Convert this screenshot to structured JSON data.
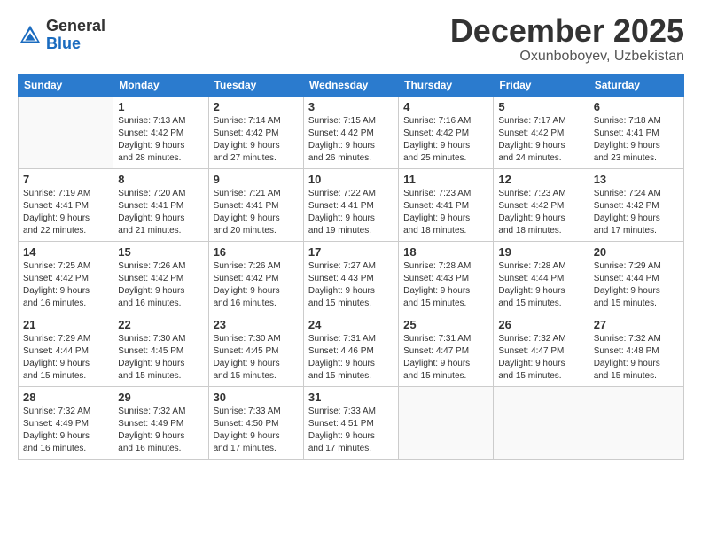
{
  "logo": {
    "general": "General",
    "blue": "Blue"
  },
  "header": {
    "month": "December 2025",
    "location": "Oxunboboyev, Uzbekistan"
  },
  "weekdays": [
    "Sunday",
    "Monday",
    "Tuesday",
    "Wednesday",
    "Thursday",
    "Friday",
    "Saturday"
  ],
  "weeks": [
    [
      {
        "day": "",
        "info": ""
      },
      {
        "day": "1",
        "info": "Sunrise: 7:13 AM\nSunset: 4:42 PM\nDaylight: 9 hours\nand 28 minutes."
      },
      {
        "day": "2",
        "info": "Sunrise: 7:14 AM\nSunset: 4:42 PM\nDaylight: 9 hours\nand 27 minutes."
      },
      {
        "day": "3",
        "info": "Sunrise: 7:15 AM\nSunset: 4:42 PM\nDaylight: 9 hours\nand 26 minutes."
      },
      {
        "day": "4",
        "info": "Sunrise: 7:16 AM\nSunset: 4:42 PM\nDaylight: 9 hours\nand 25 minutes."
      },
      {
        "day": "5",
        "info": "Sunrise: 7:17 AM\nSunset: 4:42 PM\nDaylight: 9 hours\nand 24 minutes."
      },
      {
        "day": "6",
        "info": "Sunrise: 7:18 AM\nSunset: 4:41 PM\nDaylight: 9 hours\nand 23 minutes."
      }
    ],
    [
      {
        "day": "7",
        "info": "Sunrise: 7:19 AM\nSunset: 4:41 PM\nDaylight: 9 hours\nand 22 minutes."
      },
      {
        "day": "8",
        "info": "Sunrise: 7:20 AM\nSunset: 4:41 PM\nDaylight: 9 hours\nand 21 minutes."
      },
      {
        "day": "9",
        "info": "Sunrise: 7:21 AM\nSunset: 4:41 PM\nDaylight: 9 hours\nand 20 minutes."
      },
      {
        "day": "10",
        "info": "Sunrise: 7:22 AM\nSunset: 4:41 PM\nDaylight: 9 hours\nand 19 minutes."
      },
      {
        "day": "11",
        "info": "Sunrise: 7:23 AM\nSunset: 4:41 PM\nDaylight: 9 hours\nand 18 minutes."
      },
      {
        "day": "12",
        "info": "Sunrise: 7:23 AM\nSunset: 4:42 PM\nDaylight: 9 hours\nand 18 minutes."
      },
      {
        "day": "13",
        "info": "Sunrise: 7:24 AM\nSunset: 4:42 PM\nDaylight: 9 hours\nand 17 minutes."
      }
    ],
    [
      {
        "day": "14",
        "info": "Sunrise: 7:25 AM\nSunset: 4:42 PM\nDaylight: 9 hours\nand 16 minutes."
      },
      {
        "day": "15",
        "info": "Sunrise: 7:26 AM\nSunset: 4:42 PM\nDaylight: 9 hours\nand 16 minutes."
      },
      {
        "day": "16",
        "info": "Sunrise: 7:26 AM\nSunset: 4:42 PM\nDaylight: 9 hours\nand 16 minutes."
      },
      {
        "day": "17",
        "info": "Sunrise: 7:27 AM\nSunset: 4:43 PM\nDaylight: 9 hours\nand 15 minutes."
      },
      {
        "day": "18",
        "info": "Sunrise: 7:28 AM\nSunset: 4:43 PM\nDaylight: 9 hours\nand 15 minutes."
      },
      {
        "day": "19",
        "info": "Sunrise: 7:28 AM\nSunset: 4:44 PM\nDaylight: 9 hours\nand 15 minutes."
      },
      {
        "day": "20",
        "info": "Sunrise: 7:29 AM\nSunset: 4:44 PM\nDaylight: 9 hours\nand 15 minutes."
      }
    ],
    [
      {
        "day": "21",
        "info": "Sunrise: 7:29 AM\nSunset: 4:44 PM\nDaylight: 9 hours\nand 15 minutes."
      },
      {
        "day": "22",
        "info": "Sunrise: 7:30 AM\nSunset: 4:45 PM\nDaylight: 9 hours\nand 15 minutes."
      },
      {
        "day": "23",
        "info": "Sunrise: 7:30 AM\nSunset: 4:45 PM\nDaylight: 9 hours\nand 15 minutes."
      },
      {
        "day": "24",
        "info": "Sunrise: 7:31 AM\nSunset: 4:46 PM\nDaylight: 9 hours\nand 15 minutes."
      },
      {
        "day": "25",
        "info": "Sunrise: 7:31 AM\nSunset: 4:47 PM\nDaylight: 9 hours\nand 15 minutes."
      },
      {
        "day": "26",
        "info": "Sunrise: 7:32 AM\nSunset: 4:47 PM\nDaylight: 9 hours\nand 15 minutes."
      },
      {
        "day": "27",
        "info": "Sunrise: 7:32 AM\nSunset: 4:48 PM\nDaylight: 9 hours\nand 15 minutes."
      }
    ],
    [
      {
        "day": "28",
        "info": "Sunrise: 7:32 AM\nSunset: 4:49 PM\nDaylight: 9 hours\nand 16 minutes."
      },
      {
        "day": "29",
        "info": "Sunrise: 7:32 AM\nSunset: 4:49 PM\nDaylight: 9 hours\nand 16 minutes."
      },
      {
        "day": "30",
        "info": "Sunrise: 7:33 AM\nSunset: 4:50 PM\nDaylight: 9 hours\nand 17 minutes."
      },
      {
        "day": "31",
        "info": "Sunrise: 7:33 AM\nSunset: 4:51 PM\nDaylight: 9 hours\nand 17 minutes."
      },
      {
        "day": "",
        "info": ""
      },
      {
        "day": "",
        "info": ""
      },
      {
        "day": "",
        "info": ""
      }
    ]
  ]
}
